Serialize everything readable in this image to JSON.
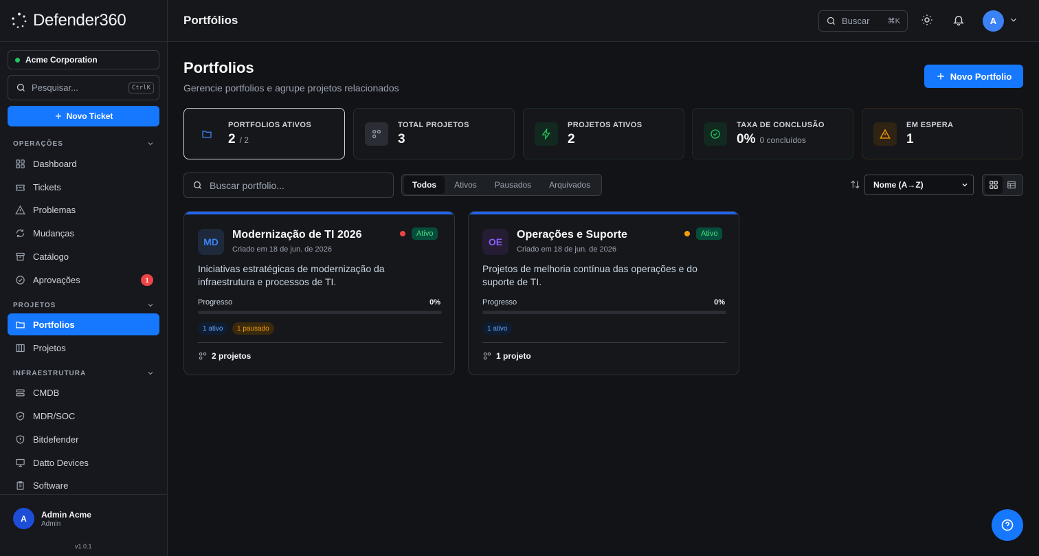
{
  "app": {
    "logo_text": "Defender360"
  },
  "sidebar": {
    "org": "Acme Corporation",
    "search_placeholder": "Pesquisar...",
    "search_kbd": "CtrlK",
    "new_ticket": "Novo Ticket",
    "sections": {
      "operacoes": "OPERAÇÕES",
      "projetos": "PROJETOS",
      "infra": "INFRAESTRUTURA"
    },
    "items": {
      "dashboard": "Dashboard",
      "tickets": "Tickets",
      "problemas": "Problemas",
      "mudancas": "Mudanças",
      "catalogo": "Catálogo",
      "aprovacoes": "Aprovações",
      "aprovacoes_badge": "1",
      "portfolios": "Portfolios",
      "projetos": "Projetos",
      "cmdb": "CMDB",
      "mdr": "MDR/SOC",
      "bitdefender": "Bitdefender",
      "datto": "Datto Devices",
      "software": "Software"
    },
    "user": {
      "initial": "A",
      "name": "Admin Acme",
      "role": "Admin"
    },
    "version": "v1.0.1"
  },
  "header": {
    "title": "Portfólios",
    "search_label": "Buscar",
    "search_kbd": "⌘K",
    "avatar_initial": "A"
  },
  "page": {
    "title": "Portfolios",
    "subtitle": "Gerencie portfolios e agrupe projetos relacionados",
    "new_button": "Novo Portfolio"
  },
  "stats": [
    {
      "label": "PORTFOLIOS ATIVOS",
      "value": "2",
      "sub": "/ 2"
    },
    {
      "label": "TOTAL PROJETOS",
      "value": "3"
    },
    {
      "label": "PROJETOS ATIVOS",
      "value": "2"
    },
    {
      "label": "TAXA DE CONCLUSÃO",
      "value": "0%",
      "sub": "0 concluídos"
    },
    {
      "label": "EM ESPERA",
      "value": "1"
    }
  ],
  "filters": {
    "search_placeholder": "Buscar portfolio...",
    "tabs": [
      "Todos",
      "Ativos",
      "Pausados",
      "Arquivados"
    ],
    "active_tab": "Todos",
    "sort_value": "Nome (A→Z)",
    "view": "grid"
  },
  "portfolios": [
    {
      "initials": "MD",
      "name": "Modernização de TI 2026",
      "created": "Criado em 18 de jun. de 2026",
      "status": "Ativo",
      "priority_color": "#ef4444",
      "description": "Iniciativas estratégicas de modernização da infraestrutura e processos de TI.",
      "progress_label": "Progresso",
      "progress": "0%",
      "progress_fraction": 0,
      "chips": [
        "1 ativo",
        "1 pausado"
      ],
      "project_count": "2 projetos"
    },
    {
      "initials": "OE",
      "name": "Operações e Suporte",
      "created": "Criado em 18 de jun. de 2026",
      "status": "Ativo",
      "priority_color": "#f59e0b",
      "description": "Projetos de melhoria contínua das operações e do suporte de TI.",
      "progress_label": "Progresso",
      "progress": "0%",
      "progress_fraction": 0,
      "chips": [
        "1 ativo"
      ],
      "project_count": "1 projeto"
    }
  ],
  "colors": {
    "accent": "#1677ff",
    "status_active": "#4ade80"
  }
}
